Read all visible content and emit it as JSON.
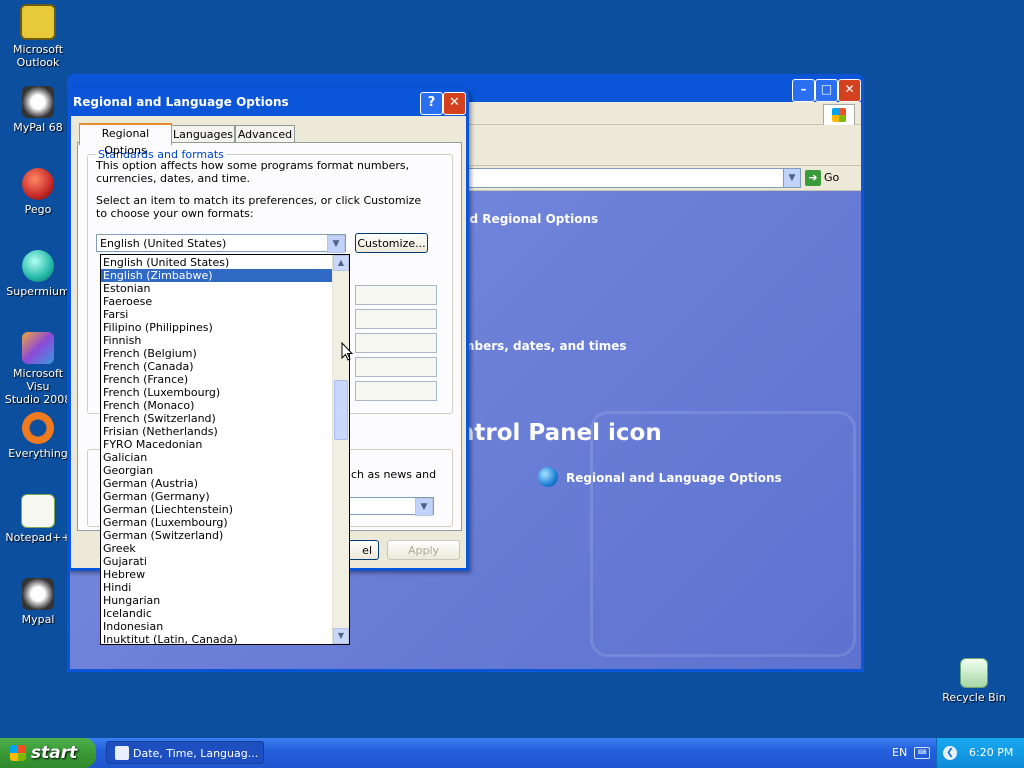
{
  "desktop": {
    "icons": [
      {
        "label": "Microsoft\nOutlook",
        "name": "outlook-shortcut"
      },
      {
        "label": "MyPal 68",
        "name": "mypal68-shortcut"
      },
      {
        "label": "Pego",
        "name": "pego-shortcut"
      },
      {
        "label": "Supermium",
        "name": "supermium-shortcut"
      },
      {
        "label": "Microsoft Visu\nStudio 2008",
        "name": "visual-studio-shortcut"
      },
      {
        "label": "Everything",
        "name": "everything-shortcut"
      },
      {
        "label": "Notepad++",
        "name": "notepadpp-shortcut"
      },
      {
        "label": "Mypal",
        "name": "mypal-shortcut"
      }
    ],
    "recycle_bin": "Recycle Bin"
  },
  "control_panel": {
    "go_label": "Go",
    "link_regional": "nd Regional Options",
    "link_numbers": "mbers, dates, and times",
    "heading_icon": "ntrol Panel icon",
    "icon_label": "Regional and Language Options"
  },
  "dialog": {
    "title": "Regional and Language Options",
    "help_btn": "?",
    "close_btn": "✕",
    "tabs": [
      "Regional Options",
      "Languages",
      "Advanced"
    ],
    "group_label": "Standards and formats",
    "desc1": "This option affects how some programs format numbers, currencies, dates, and time.",
    "desc2": "Select an item to match its preferences, or click Customize to choose your own formats:",
    "combo_value": "English (United States)",
    "customize": "Customize...",
    "location_partial": "uch as news and",
    "cancel_partial": "el",
    "apply": "Apply"
  },
  "dropdown_items": [
    "English (United States)",
    "English (Zimbabwe)",
    "Estonian",
    "Faeroese",
    "Farsi",
    "Filipino (Philippines)",
    "Finnish",
    "French (Belgium)",
    "French (Canada)",
    "French (France)",
    "French (Luxembourg)",
    "French (Monaco)",
    "French (Switzerland)",
    "Frisian (Netherlands)",
    "FYRO Macedonian",
    "Galician",
    "Georgian",
    "German (Austria)",
    "German (Germany)",
    "German (Liechtenstein)",
    "German (Luxembourg)",
    "German (Switzerland)",
    "Greek",
    "Gujarati",
    "Hebrew",
    "Hindi",
    "Hungarian",
    "Icelandic",
    "Indonesian",
    "Inuktitut (Latin, Canada)"
  ],
  "selected_index": 1,
  "taskbar": {
    "start": "start",
    "task": "Date, Time, Languag...",
    "lang": "EN",
    "clock": "6:20 PM"
  },
  "colors": {
    "desktop": "#0c4f9e",
    "titlebar": "#0a55d8",
    "selection": "#316ac5"
  }
}
